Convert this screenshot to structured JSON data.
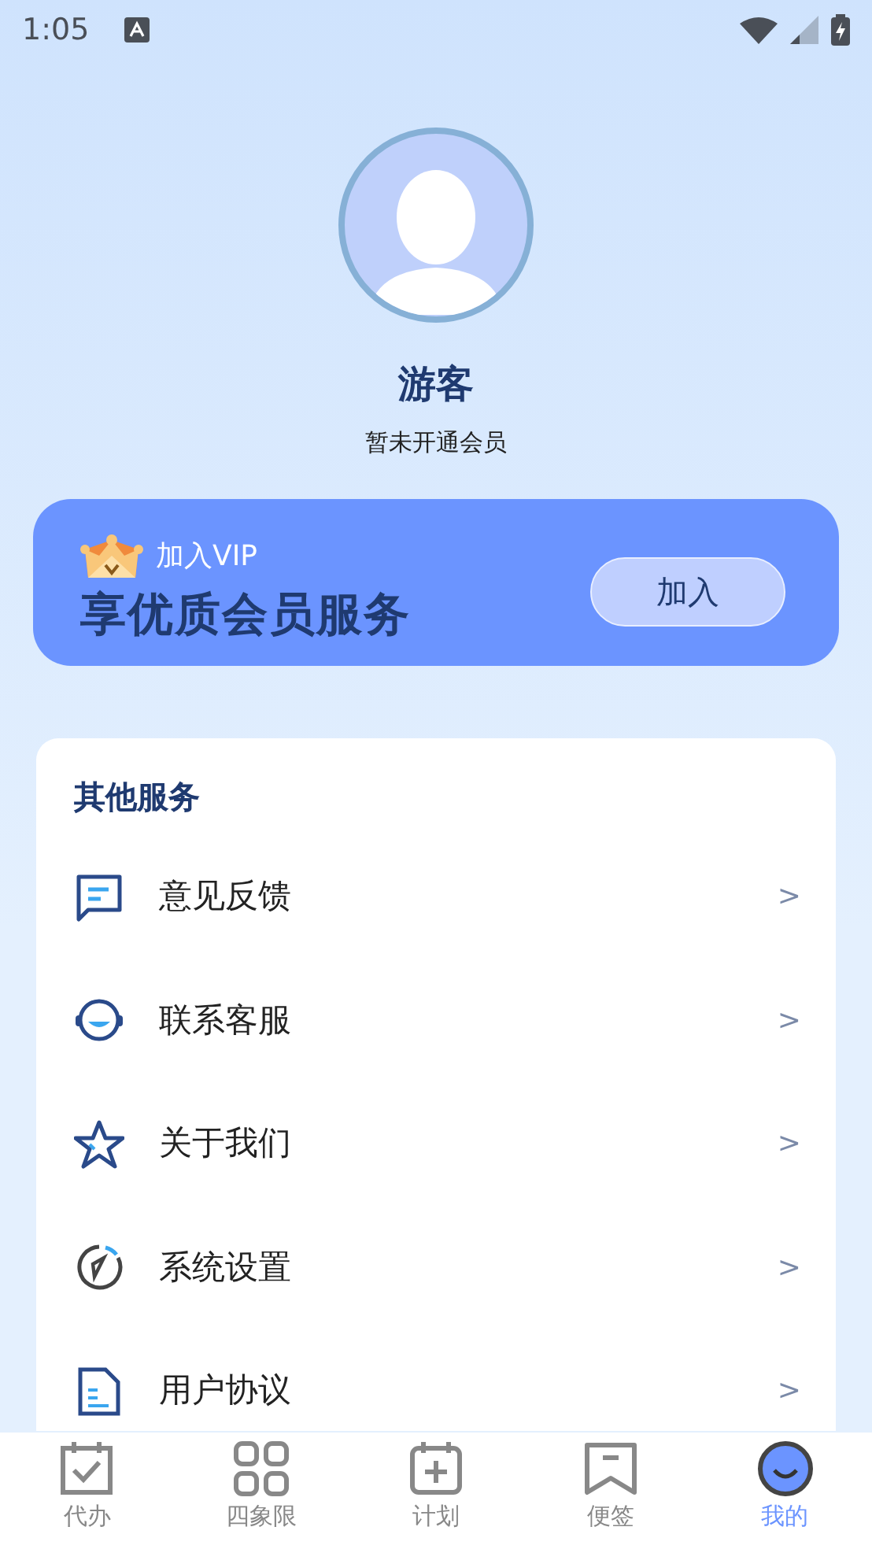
{
  "status_bar": {
    "time": "1:05"
  },
  "profile": {
    "name": "游客",
    "subtitle": "暂未开通会员"
  },
  "vip_card": {
    "tag": "加入VIP",
    "headline": "享优质会员服务",
    "button": "加入"
  },
  "services": {
    "title": "其他服务",
    "items": [
      {
        "kind": "feedback",
        "label": "意见反馈",
        "chevron": ">"
      },
      {
        "kind": "support",
        "label": "联系客服",
        "chevron": ">"
      },
      {
        "kind": "about",
        "label": "关于我们",
        "chevron": ">"
      },
      {
        "kind": "settings",
        "label": "系统设置",
        "chevron": ">"
      },
      {
        "kind": "agreement",
        "label": "用户协议",
        "chevron": ">"
      }
    ]
  },
  "tab_bar": [
    {
      "kind": "todo",
      "label": "代办",
      "selected": false
    },
    {
      "kind": "quadrant",
      "label": "四象限",
      "selected": false
    },
    {
      "kind": "plan",
      "label": "计划",
      "selected": false
    },
    {
      "kind": "note",
      "label": "便签",
      "selected": false
    },
    {
      "kind": "me",
      "label": "我的",
      "selected": true
    }
  ]
}
